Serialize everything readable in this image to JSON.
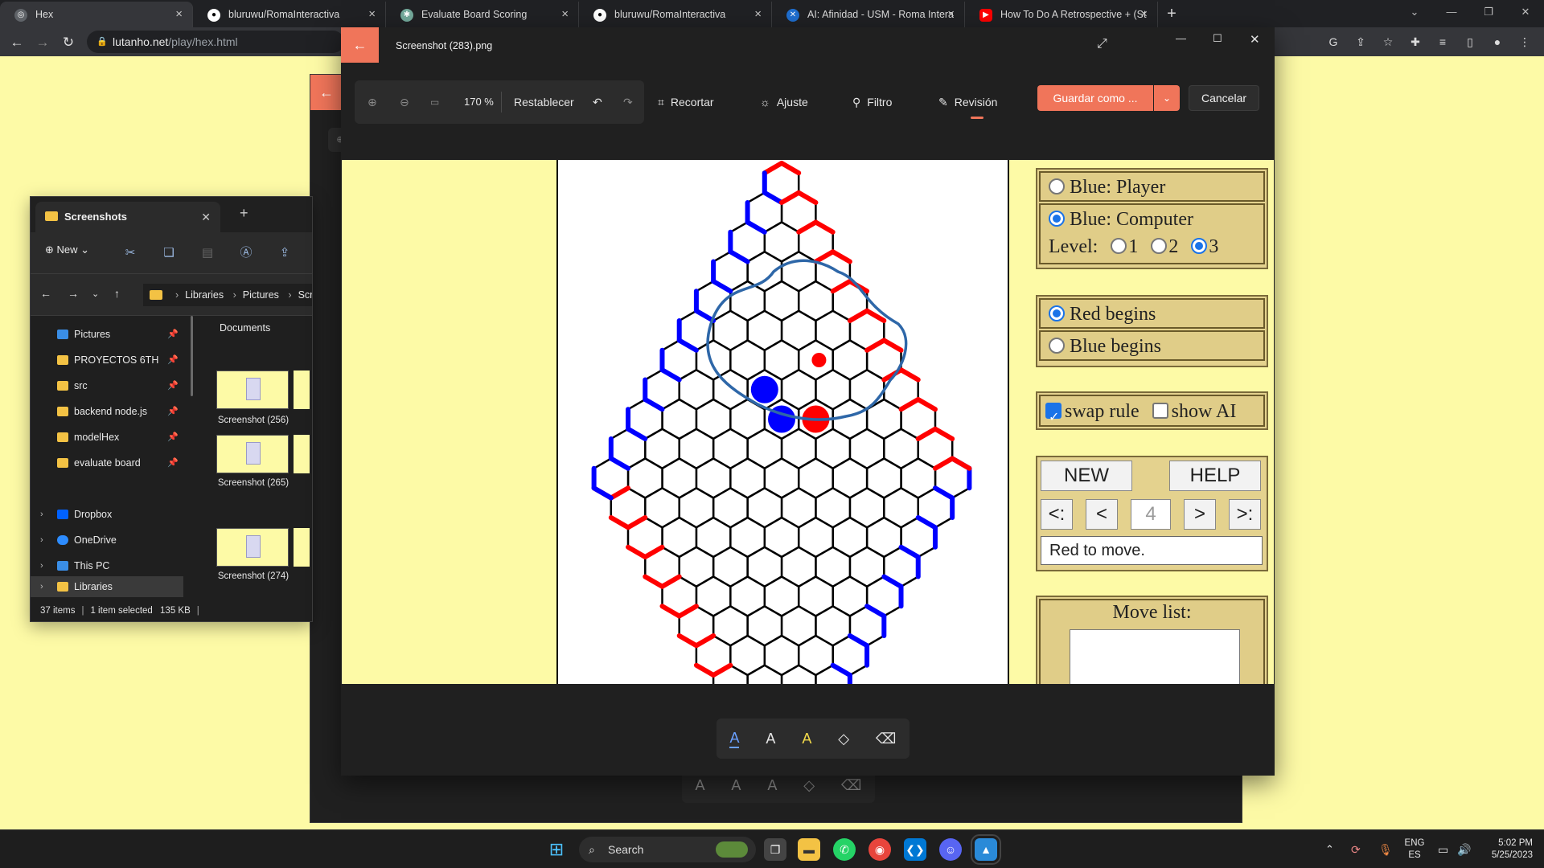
{
  "browser": {
    "tabs": [
      {
        "label": "Hex",
        "favicon_color": "#5f6368",
        "active": true
      },
      {
        "label": "bluruwu/RomaInteractiva",
        "favicon_color": "#ffffff"
      },
      {
        "label": "Evaluate Board Scoring",
        "favicon_color": "#74aa9c"
      },
      {
        "label": "bluruwu/RomaInteractiva",
        "favicon_color": "#ffffff"
      },
      {
        "label": "AI: Afinidad - USM - Roma Intera",
        "favicon_color": "#1f6fd1"
      },
      {
        "label": "How To Do A Retrospective + (St",
        "favicon_color": "#ff0000"
      }
    ],
    "url_domain": "lutanho.net",
    "url_path": "/play/hex.html"
  },
  "explorer": {
    "tab_title": "Screenshots",
    "new_label": "New",
    "breadcrumbs": [
      "Libraries",
      "Pictures",
      "Screen"
    ],
    "nav_items": [
      {
        "label": "Pictures",
        "pinned": true,
        "icon_color": "#3a8ee6"
      },
      {
        "label": "PROYECTOS 6TH",
        "pinned": true,
        "icon_color": "#f3c244"
      },
      {
        "label": "src",
        "pinned": true,
        "icon_color": "#f3c244"
      },
      {
        "label": "backend node.js",
        "pinned": true,
        "icon_color": "#f3c244"
      },
      {
        "label": "modelHex",
        "pinned": true,
        "icon_color": "#f3c244"
      },
      {
        "label": "evaluate board",
        "pinned": true,
        "icon_color": "#f3c244"
      },
      {
        "label": "Dropbox",
        "pinned": false,
        "icon_color": "#0061fe"
      },
      {
        "label": "OneDrive",
        "pinned": false,
        "icon_color": "#2d8cff"
      },
      {
        "label": "This PC",
        "pinned": false,
        "icon_color": "#3a8ee6"
      },
      {
        "label": "Libraries",
        "pinned": false,
        "icon_color": "#f3c244"
      }
    ],
    "files_header": "Documents",
    "files": [
      "Screenshot (256)",
      "Screenshot (265)",
      "Screenshot (274)"
    ],
    "status_count": "37 items",
    "status_selected": "1 item selected",
    "status_size": "135 KB"
  },
  "photos": {
    "title": "Screenshot (283).png",
    "zoom": "170 %",
    "reset_label": "Restablecer",
    "tools": [
      "Recortar",
      "Ajuste",
      "Filtro",
      "Revisión"
    ],
    "save_label": "Guardar como ...",
    "cancel_label": "Cancelar"
  },
  "hex_game": {
    "blue_player": "Blue: Player",
    "blue_computer": "Blue: Computer",
    "level_label": "Level:",
    "levels": [
      "1",
      "2",
      "3"
    ],
    "level_selected": "3",
    "red_begins": "Red begins",
    "blue_begins": "Blue begins",
    "swap_rule": "swap rule",
    "show_ai": "show AI",
    "new_button": "NEW",
    "help_button": "HELP",
    "nav_buttons": [
      "<:",
      "<",
      ">",
      ">:"
    ],
    "move_number": "4",
    "status": "Red to move.",
    "move_list_label": "Move list:",
    "colors": {
      "red": "#ff0000",
      "blue": "#0000ff",
      "annotation": "#2e67a8"
    }
  },
  "taskbar": {
    "search_label": "Search",
    "lang_top": "ENG",
    "lang_bottom": "ES",
    "time": "5:02 PM",
    "date": "5/25/2023"
  }
}
